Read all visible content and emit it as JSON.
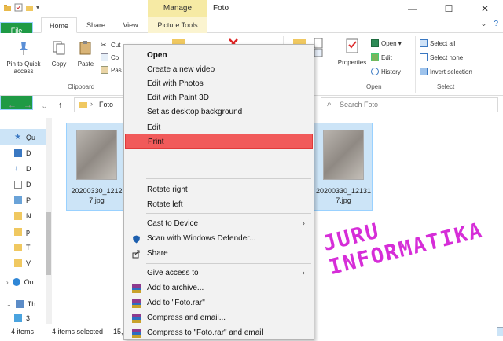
{
  "window": {
    "title": "Foto",
    "manage_label": "Manage",
    "minimize": "—",
    "maximize": "☐",
    "close": "✕"
  },
  "ribbon_tabs": {
    "file": "File",
    "home": "Home",
    "share": "Share",
    "view": "View",
    "picture_tools": "Picture Tools",
    "expand": "⌄",
    "help": "?"
  },
  "ribbon": {
    "pin": "Pin to Quick access",
    "copy": "Copy",
    "paste": "Paste",
    "cut": "Cut",
    "copy_path": "Co",
    "paste_shortcut": "Pas",
    "clipboard_group": "Clipboard",
    "properties": "Properties",
    "open": "Open ▾",
    "edit": "Edit",
    "history": "History",
    "open_group": "Open",
    "select_all": "Select all",
    "select_none": "Select none",
    "invert_selection": "Invert selection",
    "select_group": "Select"
  },
  "address": {
    "path": "Foto",
    "search_placeholder": "Search Foto"
  },
  "nav_items": [
    "Qu",
    "D",
    "D",
    "D",
    "P",
    "N",
    "p",
    "T",
    "V",
    "On",
    "Th",
    "3"
  ],
  "files": [
    {
      "name": "20200330_1212\n7.jpg"
    },
    {
      "name": "20200330_12131\n7.jpg"
    }
  ],
  "status": {
    "count": "4 items",
    "selected": "4 items selected",
    "size": "15,"
  },
  "context_menu": {
    "open": "Open",
    "create_video": "Create a new video",
    "edit_photos": "Edit with Photos",
    "edit_paint3d": "Edit with Paint 3D",
    "set_background": "Set as desktop background",
    "edit": "Edit",
    "print": "Print",
    "rotate_right": "Rotate right",
    "rotate_left": "Rotate left",
    "cast": "Cast to Device",
    "scan": "Scan with Windows Defender...",
    "share": "Share",
    "give_access": "Give access to",
    "add_archive": "Add to archive...",
    "add_rar": "Add to \"Foto.rar\"",
    "compress_email": "Compress and email...",
    "compress_rar_email": "Compress to \"Foto.rar\" and email"
  },
  "watermark": "JURU INFORMATIKA",
  "colors": {
    "highlight": "#f15a5a",
    "file_tab": "#1f9a45",
    "selection": "#cce4f7",
    "watermark": "#d62dd8"
  }
}
